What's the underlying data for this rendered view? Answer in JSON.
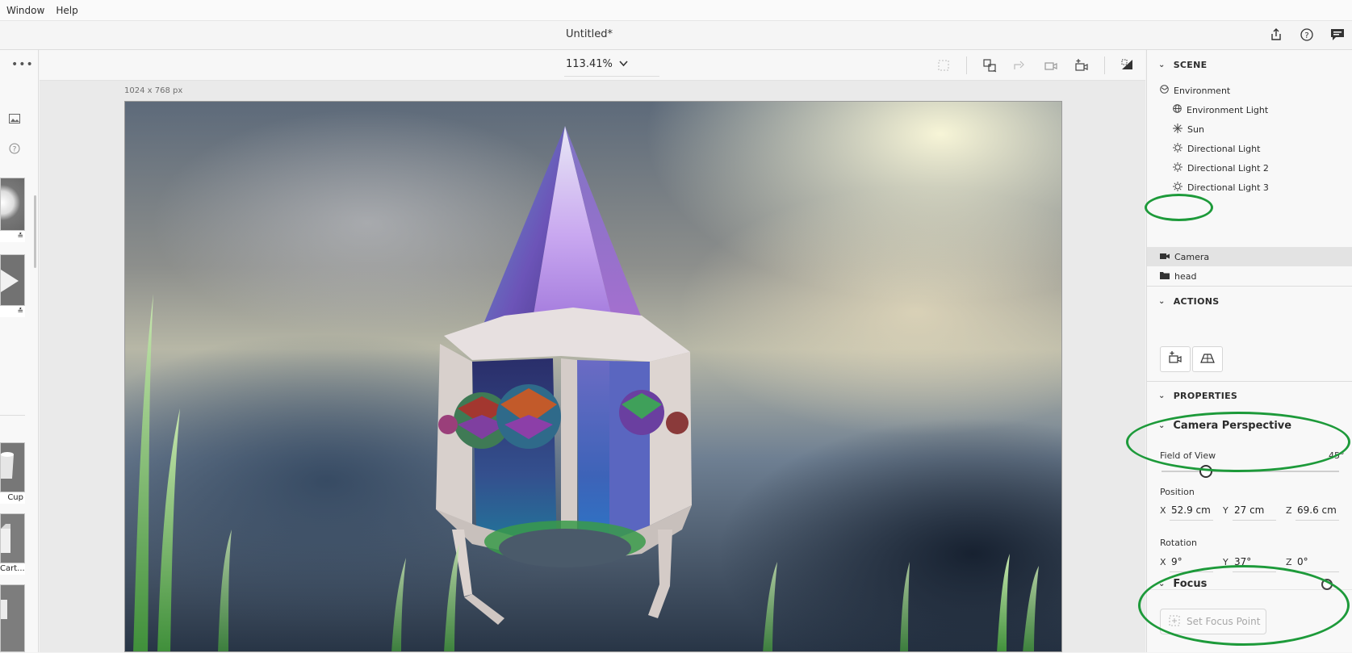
{
  "menu": {
    "window": "Window",
    "help": "Help"
  },
  "title": "Untitled*",
  "canvas": {
    "zoom": "113.41%",
    "dimensions": "1024 x 768 px"
  },
  "left_panel": {
    "asset_labels": [
      "",
      "",
      "Cup",
      "Cart..."
    ]
  },
  "scene": {
    "header": "SCENE",
    "items": [
      {
        "label": "Environment",
        "icon": "environment-icon"
      },
      {
        "label": "Environment Light",
        "icon": "globe-icon"
      },
      {
        "label": "Sun",
        "icon": "sun-icon"
      },
      {
        "label": "Directional Light",
        "icon": "light-icon"
      },
      {
        "label": "Directional Light 2",
        "icon": "light-icon"
      },
      {
        "label": "Directional Light 3",
        "icon": "light-icon"
      },
      {
        "label": "Camera",
        "icon": "camera-icon",
        "selected": true
      },
      {
        "label": "head",
        "icon": "folder-icon"
      }
    ]
  },
  "actions": {
    "header": "ACTIONS"
  },
  "properties": {
    "header": "PROPERTIES",
    "camera_perspective": "Camera Perspective",
    "field_of_view": {
      "label": "Field of View",
      "value": "45°",
      "fraction": 0.25
    },
    "position": {
      "label": "Position",
      "x_label": "X",
      "x": "52.9 cm",
      "y_label": "Y",
      "y": "27 cm",
      "z_label": "Z",
      "z": "69.6 cm"
    },
    "rotation": {
      "label": "Rotation",
      "x_label": "X",
      "x": "9°",
      "y_label": "Y",
      "y": "37°",
      "z_label": "Z",
      "z": "0°"
    },
    "focus": {
      "label": "Focus",
      "set_focus_point": "Set Focus Point"
    }
  },
  "colors": {
    "annotation": "#1d9a3a",
    "selection": "#e3e3e3"
  }
}
